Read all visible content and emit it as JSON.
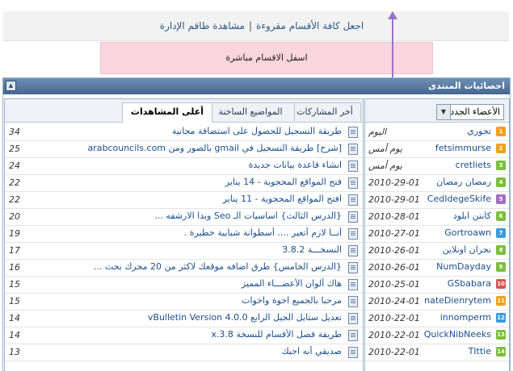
{
  "toplinks": {
    "mark_read": "اجعل كافة الأقسام مقروءة",
    "separator": "|",
    "view_staff": "مشاهدة طاقم الإدارة"
  },
  "notice": {
    "text": "اسفل الاقسام مباشرة"
  },
  "box": {
    "title": "احصائيات المنتدى"
  },
  "tabs": [
    {
      "label": "أخر المشاركات",
      "active": false
    },
    {
      "label": "المواضيع الساخنة",
      "active": false
    },
    {
      "label": "أعلى المشاهدات",
      "active": true
    }
  ],
  "topics": [
    {
      "title": "طريقة التسجيل للحصول على استضافة مجانية",
      "views": "34"
    },
    {
      "title": "[شرح] طريقة التسجيل في gmail بالصور ومن arabcouncils.com",
      "views": "25"
    },
    {
      "title": "انشاء قاعدة بيانات جديدة",
      "views": "24"
    },
    {
      "title": "فتح المواقع المحجوبة - 14 يناير",
      "views": "22"
    },
    {
      "title": "افتح المواقع المحجوبة - 11 يناير",
      "views": "22"
    },
    {
      "title": "{الدرس الثالث} اساسيات الـ Seo وبدا الارشفه ...",
      "views": "20"
    },
    {
      "title": "أنــا لازم أتغير .... أسطوانة شبابية خطيرة .",
      "views": "19"
    },
    {
      "title": "النسخـــة 3.8.2",
      "views": "17"
    },
    {
      "title": "{الدرس الخامس} طرق اضافه موقعك لاكثر من 20 محرك بحث ...",
      "views": "16"
    },
    {
      "title": "هاك ألوان الأعضـــاء المميز",
      "views": "15"
    },
    {
      "title": "مرحبا بالجميع اخوة واخوات",
      "views": "15"
    },
    {
      "title": "تعديل ستايل الجيل الرابع vBulletin Version 4.0.0",
      "views": "14"
    },
    {
      "title": "طريقة فصل الأقسام للنسخة 3.8.x",
      "views": "14"
    },
    {
      "title": "صديقي أنه احبك",
      "views": "13"
    }
  ],
  "members_panel": {
    "select_value": "الأعضاء الجدد"
  },
  "members": [
    {
      "name": "تجوري",
      "date": "اليوم",
      "rank": "1",
      "rank_color": "#f0a020"
    },
    {
      "name": "fetsimmurse",
      "date": "يوم أمس",
      "rank": "2",
      "rank_color": "#f0a020"
    },
    {
      "name": "cretliets",
      "date": "يوم أمس",
      "rank": "3",
      "rank_color": "#7bbf3c"
    },
    {
      "name": "رمضان رمضان",
      "date": "2010-29-01",
      "rank": "4",
      "rank_color": "#7bbf3c"
    },
    {
      "name": "CedIdegeSkife",
      "date": "2010-29-01",
      "rank": "5",
      "rank_color": "#a070c8"
    },
    {
      "name": "كابتن ابلود",
      "date": "2010-28-01",
      "rank": "6",
      "rank_color": "#7bbf3c"
    },
    {
      "name": "Gortroawn",
      "date": "2010-27-01",
      "rank": "7",
      "rank_color": "#3b9bd8"
    },
    {
      "name": "نجران اونلاين",
      "date": "2010-26-01",
      "rank": "8",
      "rank_color": "#7bbf3c"
    },
    {
      "name": "NumDayday",
      "date": "2010-26-01",
      "rank": "9",
      "rank_color": "#7bbf3c"
    },
    {
      "name": "GSbabara",
      "date": "2010-25-01",
      "rank": "10",
      "rank_color": "#d9534f"
    },
    {
      "name": "nateDienrytem",
      "date": "2010-24-01",
      "rank": "11",
      "rank_color": "#f0a020"
    },
    {
      "name": "innomperm",
      "date": "2010-22-01",
      "rank": "12",
      "rank_color": "#3b9bd8"
    },
    {
      "name": "QuickNibNeeks",
      "date": "2010-22-01",
      "rank": "13",
      "rank_color": "#7bbf3c"
    },
    {
      "name": "TIttie",
      "date": "2010-22-01",
      "rank": "14",
      "rank_color": "#7bbf3c"
    }
  ],
  "colors": {
    "header_gradient_top": "#6f90b5",
    "header_gradient_bottom": "#45678f",
    "notice_bg": "#f9d5dd",
    "link": "#1b4f8c",
    "arrow": "#9a72c8"
  }
}
